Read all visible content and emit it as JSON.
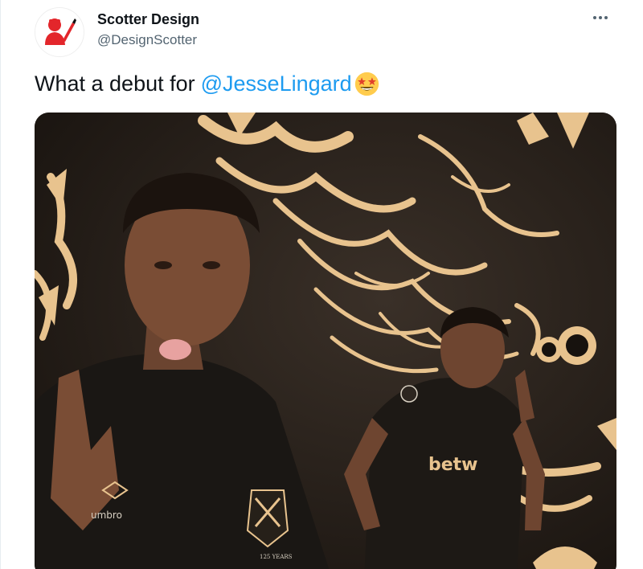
{
  "tweet": {
    "display_name": "Scotter Design",
    "handle": "@DesignScotter",
    "text": "What a debut for",
    "mention": "@JesseLingard",
    "emoji": "star-struck-emoji",
    "more_icon": "more-options-icon"
  },
  "media": {
    "kit_brand": "umbro",
    "sponsor": "betw",
    "crest_text": "125 YEARS"
  },
  "colors": {
    "mention": "#1d9bf0",
    "accent_gold": "#e8c38e",
    "avatar_red": "#e3262b",
    "background_dark": "#201a15"
  }
}
